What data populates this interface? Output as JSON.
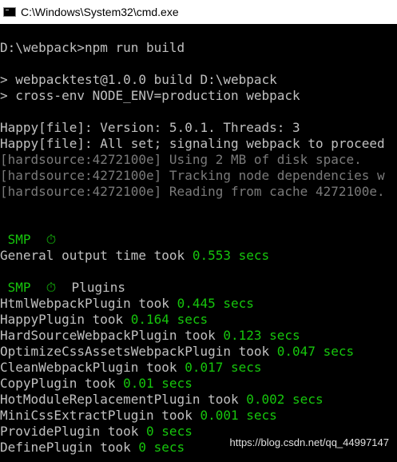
{
  "window": {
    "title": "C:\\Windows\\System32\\cmd.exe",
    "icon": "cmd-icon"
  },
  "console": {
    "prompt_line": "D:\\webpack>npm run build",
    "script_1": "> webpacktest@1.0.0 build D:\\webpack",
    "script_2": "> cross-env NODE_ENV=production webpack",
    "happy_1": "Happy[file]: Version: 5.0.1. Threads: 3",
    "happy_2": "Happy[file]: All set; signaling webpack to proceed",
    "hard_1": "[hardsource:4272100e] Using 2 MB of disk space.",
    "hard_2": "[hardsource:4272100e] Tracking node dependencies w",
    "hard_3": "[hardsource:4272100e] Reading from cache 4272100e.",
    "smp_1": " SMP  ⏱",
    "general_label": "General output time took ",
    "general_value": "0.553 secs",
    "smp_2": " SMP  ⏱",
    "smp_2_suffix": "  Plugins",
    "plugins": [
      {
        "name": "HtmlWebpackPlugin took ",
        "time": "0.445 secs"
      },
      {
        "name": "HappyPlugin took ",
        "time": "0.164 secs"
      },
      {
        "name": "HardSourceWebpackPlugin took ",
        "time": "0.123 secs"
      },
      {
        "name": "OptimizeCssAssetsWebpackPlugin took ",
        "time": "0.047 secs"
      },
      {
        "name": "CleanWebpackPlugin took ",
        "time": "0.017 secs"
      },
      {
        "name": "CopyPlugin took ",
        "time": "0.01 secs"
      },
      {
        "name": "HotModuleReplacementPlugin took ",
        "time": "0.002 secs"
      },
      {
        "name": "MiniCssExtractPlugin took ",
        "time": "0.001 secs"
      },
      {
        "name": "ProvidePlugin took ",
        "time": "0 secs"
      },
      {
        "name": "DefinePlugin took ",
        "time": "0 secs"
      }
    ]
  },
  "watermark": "https://blog.csdn.net/qq_44997147",
  "colors": {
    "background": "#000000",
    "text": "#c0c0c0",
    "dim": "#7a7a7a",
    "green": "#16c60c"
  }
}
